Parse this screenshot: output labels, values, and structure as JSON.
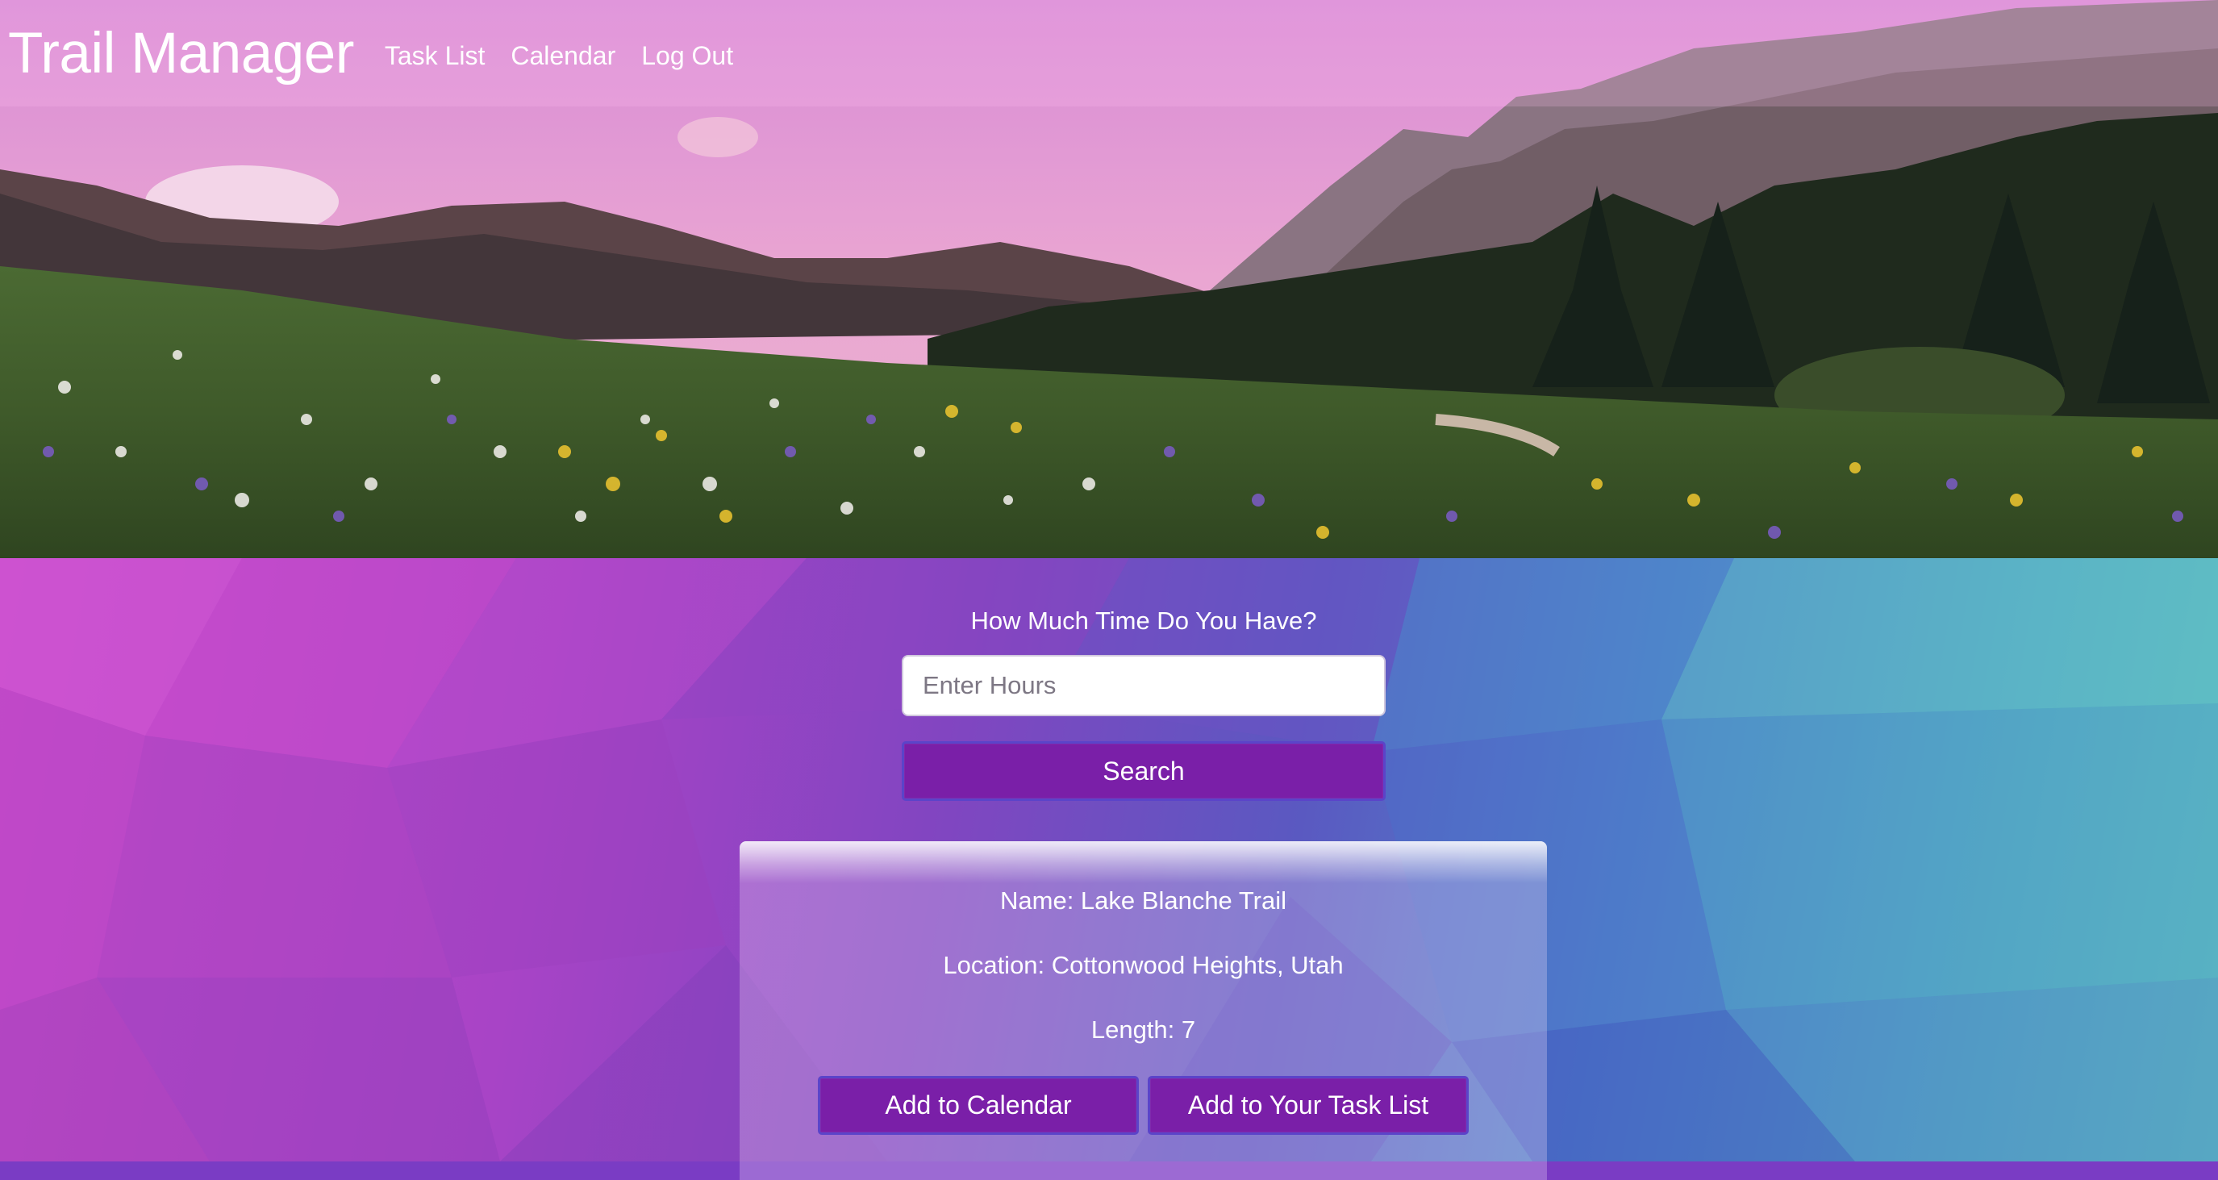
{
  "navbar": {
    "brand": "Trail Manager",
    "links": [
      {
        "label": "Task List"
      },
      {
        "label": "Calendar"
      },
      {
        "label": "Log Out"
      }
    ]
  },
  "search": {
    "question": "How Much Time Do You Have?",
    "placeholder": "Enter Hours",
    "value": "",
    "button_label": "Search"
  },
  "trail_card": {
    "name_text": "Name: Lake Blanche Trail",
    "location_text": "Location: Cottonwood Heights, Utah",
    "length_text": "Length: 7",
    "add_calendar_label": "Add to Calendar",
    "add_task_label": "Add to Your Task List"
  },
  "colors": {
    "button_bg": "#7a1fa8",
    "button_border": "#5b44c9",
    "text": "#ffffff"
  }
}
